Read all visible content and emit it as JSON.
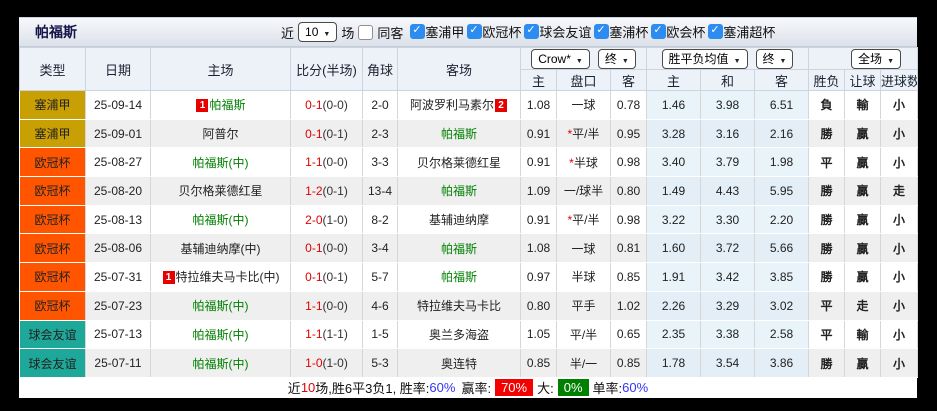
{
  "title_bar": {
    "team_name": "帕福斯",
    "recent_label": "近",
    "recent_value": "10",
    "matches_label": "场",
    "same_venue_label": "同客",
    "same_venue_checked": false,
    "league_filters": [
      {
        "label": "塞浦甲",
        "checked": true
      },
      {
        "label": "欧冠杯",
        "checked": true
      },
      {
        "label": "球会友谊",
        "checked": true
      },
      {
        "label": "塞浦杯",
        "checked": true
      },
      {
        "label": "欧会杯",
        "checked": true
      },
      {
        "label": "塞浦超杯",
        "checked": true
      }
    ]
  },
  "header": {
    "col_type": "类型",
    "col_date": "日期",
    "col_home": "主场",
    "col_score": "比分(半场)",
    "col_corner": "角球",
    "col_away": "客场",
    "select_crow": "Crow*",
    "select_final_1": "终",
    "select_wdl_avg": "胜平负均值",
    "select_final_2": "终",
    "select_scope": "全场",
    "sub": [
      "主",
      "盘口",
      "客",
      "主",
      "和",
      "客",
      "胜负",
      "让球",
      "进球数"
    ]
  },
  "colors": {
    "league_cyprus1": "#C9A003",
    "league_ucl": "#FF5500",
    "league_friendly": "#1EA89A",
    "score_red": "#E00000",
    "team_green": "#008000",
    "result_red": "#C40000",
    "result_green": "#007A00",
    "result_blue": "#2020DD",
    "rate_red_bg": "#F40000",
    "rate_green_bg": "#008000",
    "rate_blue": "#3333FF"
  },
  "table": {
    "rows": [
      {
        "league": "塞浦甲",
        "league_color": "#C9A003",
        "date": "25-09-14",
        "home": {
          "badge_before": "1",
          "text": "帕福斯",
          "green": true,
          "badge_after": ""
        },
        "score": "0-1",
        "half": "(0-0)",
        "corner": "2-0",
        "away": {
          "badge_before": "",
          "text": "阿波罗利马素尔",
          "green": false,
          "badge_after": "2"
        },
        "odds": {
          "home": "1.08",
          "star": "",
          "handicap": "一球",
          "away": "0.78"
        },
        "avg": {
          "win": "1.46",
          "draw": "3.98",
          "lose": "6.51"
        },
        "results": [
          {
            "text": "負",
            "c": "g"
          },
          {
            "text": "輸",
            "c": "g"
          },
          {
            "text": "小",
            "c": "g"
          }
        ]
      },
      {
        "league": "塞浦甲",
        "league_color": "#C9A003",
        "date": "25-09-01",
        "home": {
          "badge_before": "",
          "text": "阿普尔",
          "green": false,
          "badge_after": ""
        },
        "score": "0-1",
        "half": "(0-1)",
        "corner": "2-3",
        "away": {
          "badge_before": "",
          "text": "帕福斯",
          "green": true,
          "badge_after": ""
        },
        "odds": {
          "home": "0.91",
          "star": "*",
          "handicap": "平/半",
          "away": "0.95"
        },
        "avg": {
          "win": "3.28",
          "draw": "3.16",
          "lose": "2.16"
        },
        "results": [
          {
            "text": "勝",
            "c": "r"
          },
          {
            "text": "贏",
            "c": "r"
          },
          {
            "text": "小",
            "c": "g"
          }
        ]
      },
      {
        "league": "欧冠杯",
        "league_color": "#FF5500",
        "date": "25-08-27",
        "home": {
          "badge_before": "",
          "text": "帕福斯(中)",
          "green": true,
          "badge_after": ""
        },
        "score": "1-1",
        "half": "(0-0)",
        "corner": "3-3",
        "away": {
          "badge_before": "",
          "text": "贝尔格莱德红星",
          "green": false,
          "badge_after": ""
        },
        "odds": {
          "home": "0.91",
          "star": "*",
          "handicap": "半球",
          "away": "0.98"
        },
        "avg": {
          "win": "3.40",
          "draw": "3.79",
          "lose": "1.98"
        },
        "results": [
          {
            "text": "平",
            "c": "b"
          },
          {
            "text": "贏",
            "c": "r"
          },
          {
            "text": "小",
            "c": "g"
          }
        ]
      },
      {
        "league": "欧冠杯",
        "league_color": "#FF5500",
        "date": "25-08-20",
        "home": {
          "badge_before": "",
          "text": "贝尔格莱德红星",
          "green": false,
          "badge_after": ""
        },
        "score": "1-2",
        "half": "(0-1)",
        "corner": "13-4",
        "away": {
          "badge_before": "",
          "text": "帕福斯",
          "green": true,
          "badge_after": ""
        },
        "odds": {
          "home": "1.09",
          "star": "",
          "handicap": "一/球半",
          "away": "0.80"
        },
        "avg": {
          "win": "1.49",
          "draw": "4.43",
          "lose": "5.95"
        },
        "results": [
          {
            "text": "勝",
            "c": "r"
          },
          {
            "text": "贏",
            "c": "r"
          },
          {
            "text": "走",
            "c": "b"
          }
        ]
      },
      {
        "league": "欧冠杯",
        "league_color": "#FF5500",
        "date": "25-08-13",
        "home": {
          "badge_before": "",
          "text": "帕福斯(中)",
          "green": true,
          "badge_after": ""
        },
        "score": "2-0",
        "half": "(1-0)",
        "corner": "8-2",
        "away": {
          "badge_before": "",
          "text": "基辅迪纳摩",
          "green": false,
          "badge_after": ""
        },
        "odds": {
          "home": "0.91",
          "star": "*",
          "handicap": "平/半",
          "away": "0.98"
        },
        "avg": {
          "win": "3.22",
          "draw": "3.30",
          "lose": "2.20"
        },
        "results": [
          {
            "text": "勝",
            "c": "r"
          },
          {
            "text": "贏",
            "c": "r"
          },
          {
            "text": "小",
            "c": "g"
          }
        ]
      },
      {
        "league": "欧冠杯",
        "league_color": "#FF5500",
        "date": "25-08-06",
        "home": {
          "badge_before": "",
          "text": "基辅迪纳摩(中)",
          "green": false,
          "badge_after": ""
        },
        "score": "0-1",
        "half": "(0-0)",
        "corner": "3-4",
        "away": {
          "badge_before": "",
          "text": "帕福斯",
          "green": true,
          "badge_after": ""
        },
        "odds": {
          "home": "1.08",
          "star": "",
          "handicap": "一球",
          "away": "0.81"
        },
        "avg": {
          "win": "1.60",
          "draw": "3.72",
          "lose": "5.66"
        },
        "results": [
          {
            "text": "勝",
            "c": "r"
          },
          {
            "text": "贏",
            "c": "r"
          },
          {
            "text": "小",
            "c": "g"
          }
        ]
      },
      {
        "league": "欧冠杯",
        "league_color": "#FF5500",
        "date": "25-07-31",
        "home": {
          "badge_before": "1",
          "text": "特拉维夫马卡比(中)",
          "green": false,
          "badge_after": ""
        },
        "score": "0-1",
        "half": "(0-1)",
        "corner": "5-7",
        "away": {
          "badge_before": "",
          "text": "帕福斯",
          "green": true,
          "badge_after": ""
        },
        "odds": {
          "home": "0.97",
          "star": "",
          "handicap": "半球",
          "away": "0.85"
        },
        "avg": {
          "win": "1.91",
          "draw": "3.42",
          "lose": "3.85"
        },
        "results": [
          {
            "text": "勝",
            "c": "r"
          },
          {
            "text": "贏",
            "c": "r"
          },
          {
            "text": "小",
            "c": "g"
          }
        ]
      },
      {
        "league": "欧冠杯",
        "league_color": "#FF5500",
        "date": "25-07-23",
        "home": {
          "badge_before": "",
          "text": "帕福斯(中)",
          "green": true,
          "badge_after": ""
        },
        "score": "1-1",
        "half": "(0-0)",
        "corner": "4-6",
        "away": {
          "badge_before": "",
          "text": "特拉维夫马卡比",
          "green": false,
          "badge_after": ""
        },
        "odds": {
          "home": "0.80",
          "star": "",
          "handicap": "平手",
          "away": "1.02"
        },
        "avg": {
          "win": "2.26",
          "draw": "3.29",
          "lose": "3.02"
        },
        "results": [
          {
            "text": "平",
            "c": "b"
          },
          {
            "text": "走",
            "c": "b"
          },
          {
            "text": "小",
            "c": "g"
          }
        ]
      },
      {
        "league": "球会友谊",
        "league_color": "#1EA89A",
        "date": "25-07-13",
        "home": {
          "badge_before": "",
          "text": "帕福斯(中)",
          "green": true,
          "badge_after": ""
        },
        "score": "1-1",
        "half": "(1-1)",
        "corner": "1-5",
        "away": {
          "badge_before": "",
          "text": "奥兰多海盗",
          "green": false,
          "badge_after": ""
        },
        "odds": {
          "home": "1.05",
          "star": "",
          "handicap": "平/半",
          "away": "0.65"
        },
        "avg": {
          "win": "2.35",
          "draw": "3.38",
          "lose": "2.58"
        },
        "results": [
          {
            "text": "平",
            "c": "b"
          },
          {
            "text": "輸",
            "c": "g"
          },
          {
            "text": "小",
            "c": "g"
          }
        ]
      },
      {
        "league": "球会友谊",
        "league_color": "#1EA89A",
        "date": "25-07-11",
        "home": {
          "badge_before": "",
          "text": "帕福斯(中)",
          "green": true,
          "badge_after": ""
        },
        "score": "1-0",
        "half": "(1-0)",
        "corner": "5-3",
        "away": {
          "badge_before": "",
          "text": "奥连特",
          "green": false,
          "badge_after": ""
        },
        "odds": {
          "home": "0.85",
          "star": "",
          "handicap": "半/一",
          "away": "0.85"
        },
        "avg": {
          "win": "1.78",
          "draw": "3.54",
          "lose": "3.86"
        },
        "results": [
          {
            "text": "勝",
            "c": "r"
          },
          {
            "text": "贏",
            "c": "r"
          },
          {
            "text": "小",
            "c": "g"
          }
        ]
      }
    ]
  },
  "footer": {
    "prefix": "近",
    "count": "10",
    "text_mid": "场,胜6平3负1, 胜率:",
    "win_rate": "60%",
    "label_yingrate": "赢率:",
    "ying_rate": "70%",
    "label_big": "大:",
    "big_rate": "0%",
    "label_single": "单率:",
    "single_rate": "60%"
  }
}
